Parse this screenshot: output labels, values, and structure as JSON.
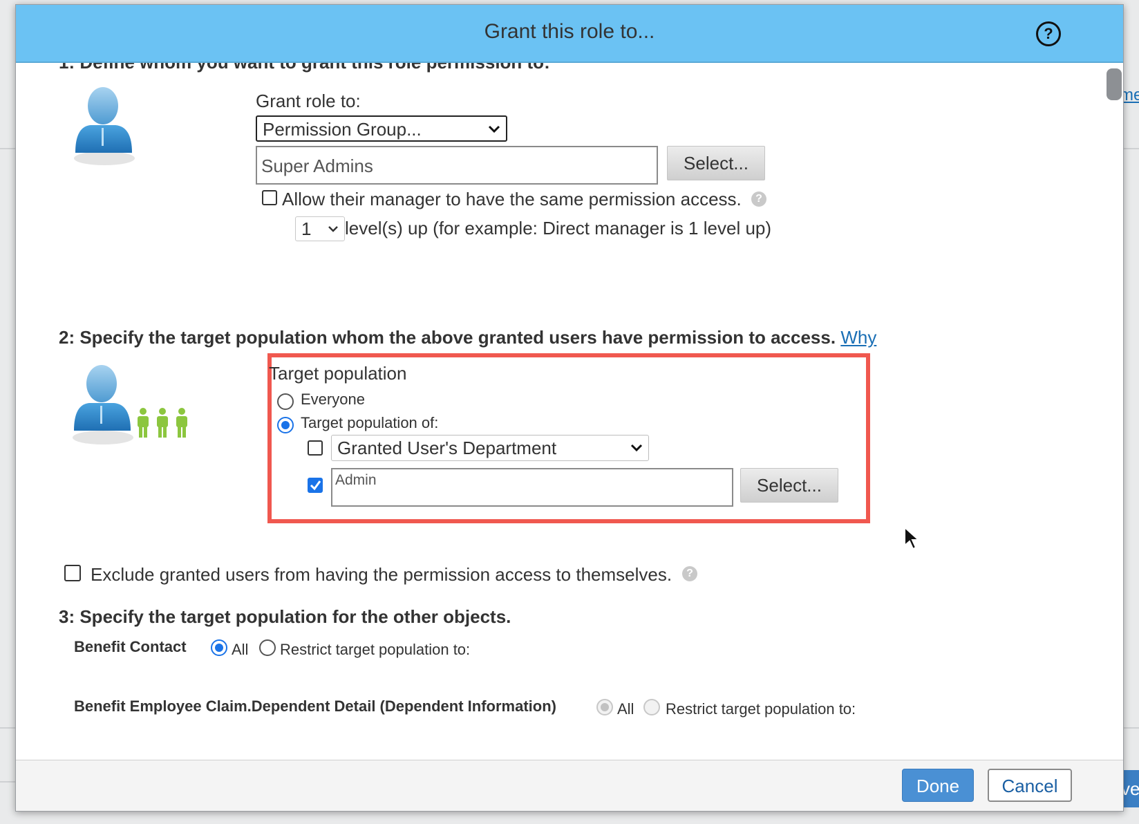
{
  "background": {
    "side_link": "me",
    "side_button": "ve"
  },
  "dialog": {
    "title": "Grant this role to...",
    "help_icon": "question-circle-icon",
    "section1": {
      "heading_clipped": "1: Define whom you want to grant this role permission to:",
      "grant_role_to_label": "Grant role to:",
      "grant_role_to_value": "Permission Group...",
      "group_value": "Super Admins",
      "select_button": "Select...",
      "manager_checkbox_label": "Allow their manager to have the same permission access.",
      "manager_checked": false,
      "level_value": "1",
      "level_label": "level(s) up (for example: Direct manager is 1 level up)"
    },
    "section2": {
      "heading": "2: Specify the target population whom the above granted users have permission to access.",
      "why_link": "Why",
      "box_title": "Target population",
      "option_everyone": "Everyone",
      "option_target_of": "Target population of:",
      "selected_option": "Target population of:",
      "department_checked": false,
      "department_value": "Granted User's Department",
      "group_checked": true,
      "group_value": "Admin",
      "select_button": "Select..."
    },
    "exclude_label": "Exclude granted users from having the permission access to themselves.",
    "exclude_checked": false,
    "section3": {
      "heading": "3: Specify the target population for the other objects.",
      "rows": [
        {
          "object": "Benefit Contact",
          "all_label": "All",
          "restrict_label": "Restrict target population to:",
          "selected": "All",
          "disabled": false
        },
        {
          "object": "Benefit Employee Claim.Dependent Detail (Dependent Information)",
          "all_label": "All",
          "restrict_label": "Restrict target population to:",
          "selected": "All",
          "disabled": true
        }
      ]
    },
    "footer": {
      "done": "Done",
      "cancel": "Cancel"
    }
  },
  "colors": {
    "titlebar": "#6bc2f3",
    "highlight": "#f0584f",
    "primary": "#4a90d4",
    "link": "#1a6fb5"
  }
}
